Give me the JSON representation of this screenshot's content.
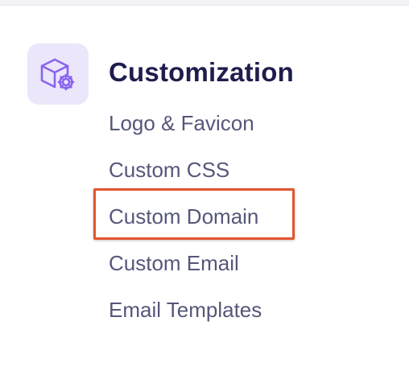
{
  "section": {
    "title": "Customization",
    "icon": "cube-gear-icon",
    "accent_color": "#8a63f0",
    "tile_color": "#ece6fb"
  },
  "nav": {
    "items": [
      {
        "label": "Logo & Favicon"
      },
      {
        "label": "Custom CSS"
      },
      {
        "label": "Custom Domain",
        "highlighted": true
      },
      {
        "label": "Custom Email"
      },
      {
        "label": "Email Templates"
      }
    ]
  },
  "highlight": {
    "color": "#e25530",
    "target": "Custom Domain"
  }
}
